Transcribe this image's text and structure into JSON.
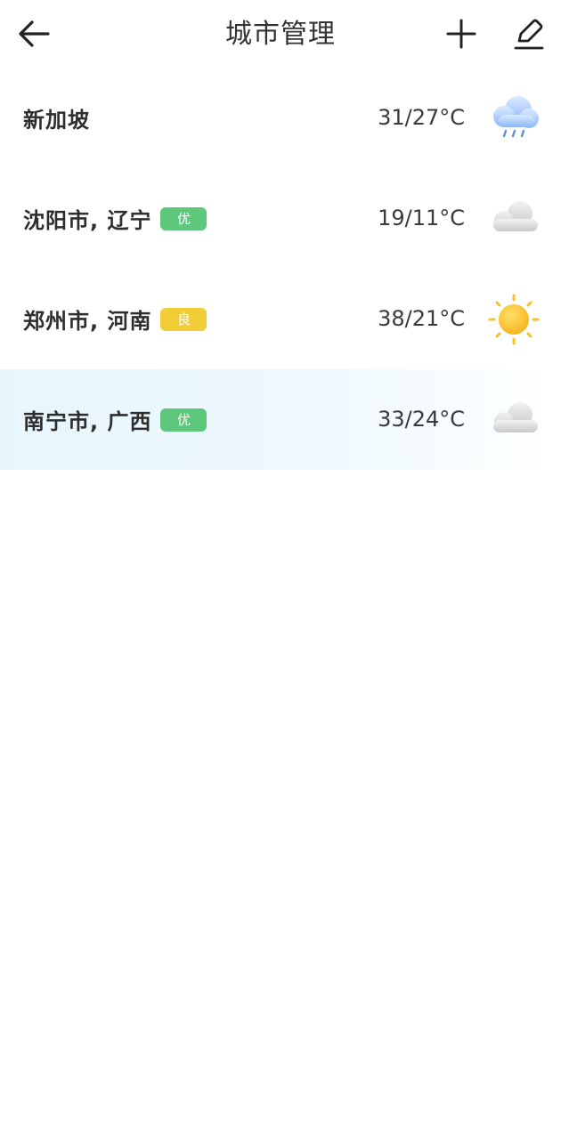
{
  "header": {
    "title": "城市管理",
    "back_icon": "arrow-left-icon",
    "add_icon": "plus-icon",
    "edit_icon": "pencil-icon"
  },
  "cities": [
    {
      "name": "新加坡",
      "aqi": "",
      "aqi_color": "",
      "temp": "31/27°C",
      "weather_icon": "rain-cloud-icon"
    },
    {
      "name": "沈阳市, 辽宁",
      "aqi": "优",
      "aqi_color": "#5dc77b",
      "temp": "19/11°C",
      "weather_icon": "cloudy-icon"
    },
    {
      "name": "郑州市, 河南",
      "aqi": "良",
      "aqi_color": "#f1cd38",
      "temp": "38/21°C",
      "weather_icon": "sunny-icon"
    },
    {
      "name": "南宁市, 广西",
      "aqi": "优",
      "aqi_color": "#5dc77b",
      "temp": "33/24°C",
      "weather_icon": "cloudy-icon"
    }
  ]
}
